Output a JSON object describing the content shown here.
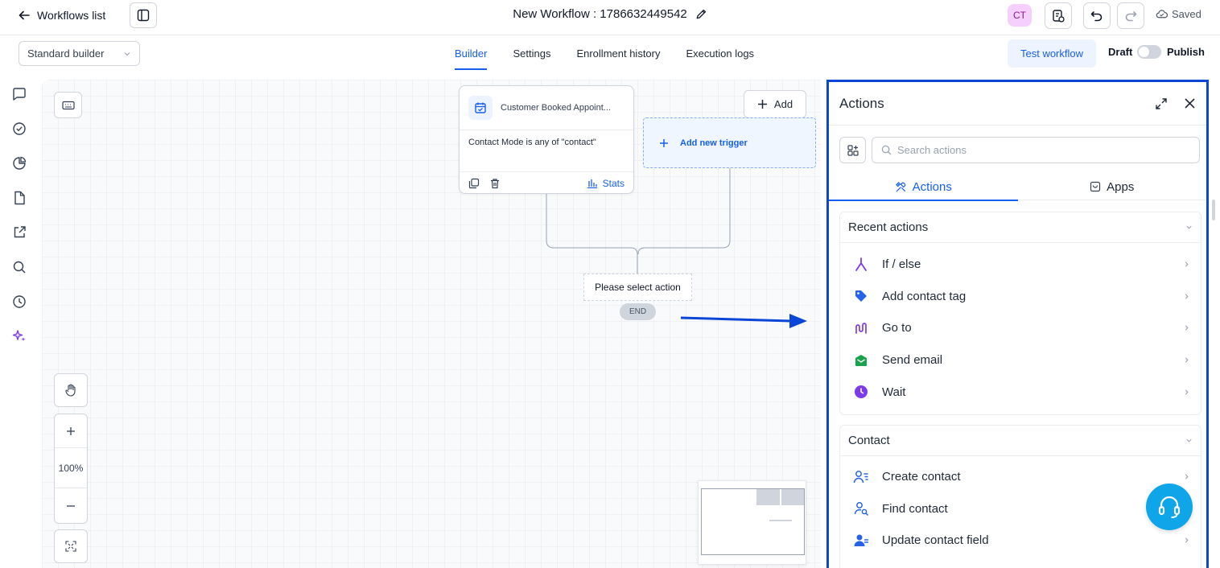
{
  "topbar": {
    "back_label": "Workflows list",
    "workflow_title": "New Workflow : 1786632449542",
    "avatar_initials": "CT",
    "saved_label": "Saved"
  },
  "subbar": {
    "builder_mode": "Standard builder",
    "tabs": [
      {
        "label": "Builder",
        "active": true
      },
      {
        "label": "Settings",
        "active": false
      },
      {
        "label": "Enrollment history",
        "active": false
      },
      {
        "label": "Execution logs",
        "active": false
      }
    ],
    "test_label": "Test workflow",
    "draft_label": "Draft",
    "publish_label": "Publish"
  },
  "rail": {
    "icons": [
      "chat-icon",
      "check-circle-icon",
      "pie-chart-icon",
      "file-icon",
      "external-link-icon",
      "search-icon",
      "history-icon",
      "sparkles-icon"
    ]
  },
  "canvas": {
    "trigger": {
      "name": "Customer Booked Appoint...",
      "condition": "Contact Mode is any of \"contact\"",
      "stats_label": "Stats"
    },
    "add_trigger_label": "Add new trigger",
    "add_label": "Add",
    "select_action_label": "Please select action",
    "end_label": "END",
    "zoom_label": "100%"
  },
  "panel": {
    "title": "Actions",
    "search_placeholder": "Search actions",
    "tabs": [
      {
        "label": "Actions",
        "active": true
      },
      {
        "label": "Apps",
        "active": false
      }
    ],
    "recent": {
      "heading": "Recent actions",
      "items": [
        {
          "label": "If / else",
          "icon": "branch-icon",
          "color": "#7c3aed"
        },
        {
          "label": "Add contact tag",
          "icon": "tag-icon",
          "color": "#2563eb"
        },
        {
          "label": "Go to",
          "icon": "goto-icon",
          "color": "#7c3aed"
        },
        {
          "label": "Send email",
          "icon": "email-icon",
          "color": "#16a34a"
        },
        {
          "label": "Wait",
          "icon": "clock-icon",
          "color": "#7c3aed"
        }
      ]
    },
    "contact": {
      "heading": "Contact",
      "items": [
        {
          "label": "Create contact",
          "icon": "user-list-icon"
        },
        {
          "label": "Find contact",
          "icon": "user-search-icon"
        },
        {
          "label": "Update contact field",
          "icon": "user-edit-icon"
        }
      ]
    }
  },
  "colors": {
    "accent": "#155eef",
    "highlight_border": "#0b46d6",
    "support_button": "#0ea5e9"
  }
}
